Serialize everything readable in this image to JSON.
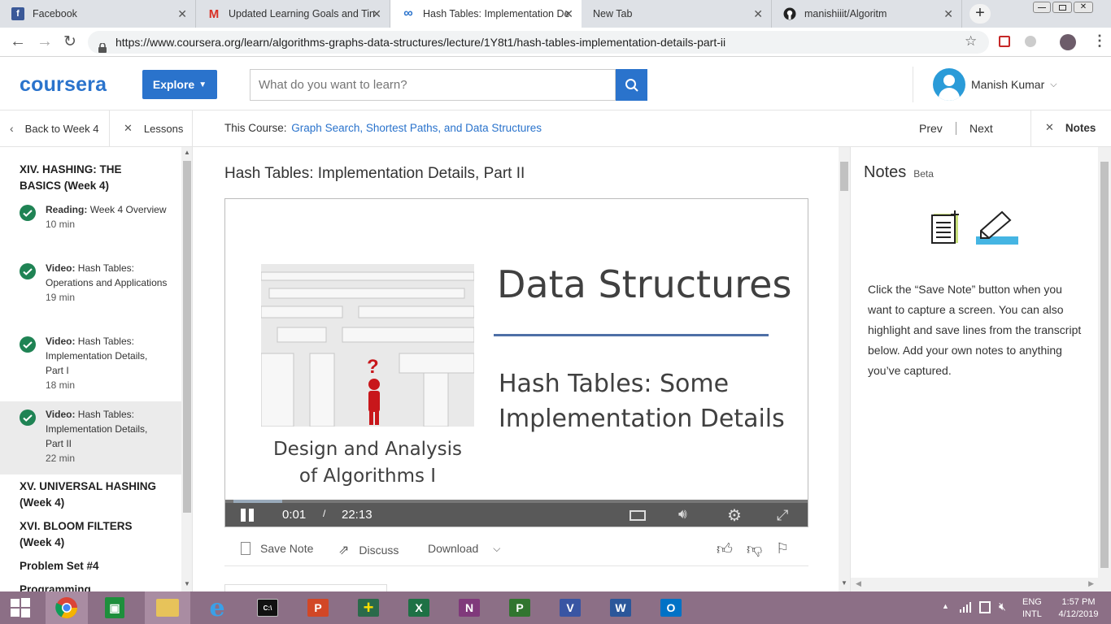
{
  "browser": {
    "tabs": [
      {
        "title": "Facebook",
        "icon": "facebook-icon",
        "color": "#3b5998",
        "glyph": "f"
      },
      {
        "title": "Updated Learning Goals and Tin",
        "icon": "gmail-icon",
        "color": "#d93025",
        "glyph": "M"
      },
      {
        "title": "Hash Tables: Implementation De",
        "icon": "coursera-icon",
        "color": "#2a73cc",
        "glyph": "∞"
      },
      {
        "title": "New Tab",
        "icon": "newtab-icon",
        "color": "#999999",
        "glyph": ""
      },
      {
        "title": "manishiiit/Algoritm",
        "icon": "github-icon",
        "color": "#222222",
        "glyph": "●"
      }
    ],
    "url": "https://www.coursera.org/learn/algorithms-graphs-data-structures/lecture/1Y8t1/hash-tables-implementation-details-part-ii"
  },
  "header": {
    "logo": "coursera",
    "explore_label": "Explore",
    "search_placeholder": "What do you want to learn?",
    "user_name": "Manish Kumar"
  },
  "subnav": {
    "back_label": "Back to Week 4",
    "lessons_label": "Lessons",
    "course_prefix": "This Course:",
    "course_name": "Graph Search, Shortest Paths, and Data Structures",
    "prev_label": "Prev",
    "next_label": "Next",
    "notes_label": "Notes"
  },
  "sidebar": {
    "section_title": "XIV. HASHING: THE BASICS (Week 4)",
    "items": [
      {
        "kind": "Reading:",
        "title": "Week 4 Overview",
        "duration": "10 min"
      },
      {
        "kind": "Video:",
        "title": "Hash Tables: Operations and Applications",
        "duration": "19 min"
      },
      {
        "kind": "Video:",
        "title": "Hash Tables: Implementation Details, Part I",
        "duration": "18 min"
      },
      {
        "kind": "Video:",
        "title": "Hash Tables: Implementation Details, Part II",
        "duration": "22 min"
      }
    ],
    "sections_after": [
      "XV. UNIVERSAL HASHING (Week 4)",
      "XVI. BLOOM FILTERS (Week 4)",
      "Problem Set #4",
      "Programming"
    ]
  },
  "lecture": {
    "title": "Hash Tables: Implementation Details, Part II",
    "slide": {
      "heading": "Data Structures",
      "subtitle_line1": "Hash Tables: Some",
      "subtitle_line2": "Implementation Details",
      "course_line1": "Design and Analysis",
      "course_line2": "of Algorithms I"
    },
    "player": {
      "current_time": "0:01",
      "separator": "/",
      "total_time": "22:13",
      "progress": 0.0
    },
    "actions": {
      "save_note": "Save Note",
      "discuss": "Discuss",
      "download": "Download"
    }
  },
  "notes": {
    "title": "Notes",
    "beta": "Beta",
    "body": "Click the “Save Note” button when you want to capture a screen. You can also highlight and save lines from the transcript below. Add your own notes to anything you’ve captured."
  },
  "taskbar": {
    "apps": [
      {
        "name": "chrome",
        "label": ""
      },
      {
        "name": "store",
        "label": ""
      },
      {
        "name": "file-explorer",
        "label": ""
      },
      {
        "name": "internet-explorer",
        "label": "e"
      },
      {
        "name": "cmd",
        "label": "C:\\"
      },
      {
        "name": "powerpoint",
        "label": "P"
      },
      {
        "name": "calculator",
        "label": "+"
      },
      {
        "name": "excel",
        "label": "X"
      },
      {
        "name": "onenote",
        "label": "N"
      },
      {
        "name": "project",
        "label": "P"
      },
      {
        "name": "visio",
        "label": "V"
      },
      {
        "name": "word",
        "label": "W"
      },
      {
        "name": "outlook",
        "label": "O"
      }
    ],
    "lang_line1": "ENG",
    "lang_line2": "INTL",
    "time": "1:57 PM",
    "date": "4/12/2019"
  },
  "colors": {
    "brand": "#2a73cc",
    "complete": "#1f8354",
    "taskbar": "#8c6f86"
  }
}
